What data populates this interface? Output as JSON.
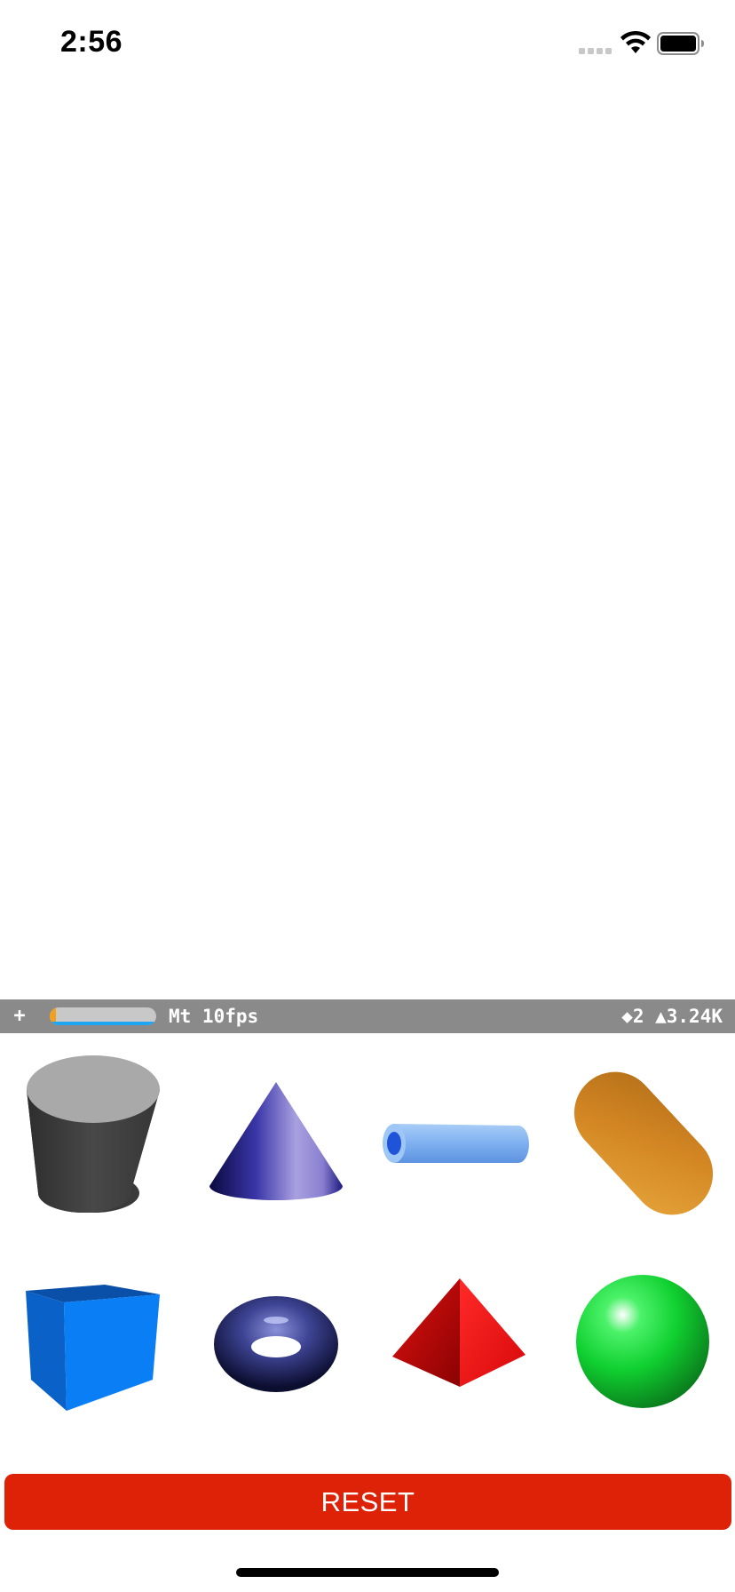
{
  "status_bar": {
    "time": "2:56"
  },
  "stats_bar": {
    "add_label": "+",
    "gauge_fraction": 0.06,
    "fps_text": "Mt 10fps",
    "counts_text": "◆2 ▲3.24K"
  },
  "shapes": [
    {
      "name": "cylinder",
      "icon": "cylinder-icon",
      "color": "#4a4a4a"
    },
    {
      "name": "cone",
      "icon": "cone-icon",
      "color": "#5a4fc0"
    },
    {
      "name": "tube",
      "icon": "tube-icon",
      "color": "#7fb0f0"
    },
    {
      "name": "capsule",
      "icon": "capsule-icon",
      "color": "#d38a22"
    },
    {
      "name": "box",
      "icon": "box-icon",
      "color": "#0a78f0"
    },
    {
      "name": "torus",
      "icon": "torus-icon",
      "color": "#3a3f8a"
    },
    {
      "name": "pyramid",
      "icon": "pyramid-icon",
      "color": "#e01010"
    },
    {
      "name": "sphere",
      "icon": "sphere-icon",
      "color": "#10d030"
    }
  ],
  "reset_button": {
    "label": "RESET",
    "color": "#dd2208"
  }
}
